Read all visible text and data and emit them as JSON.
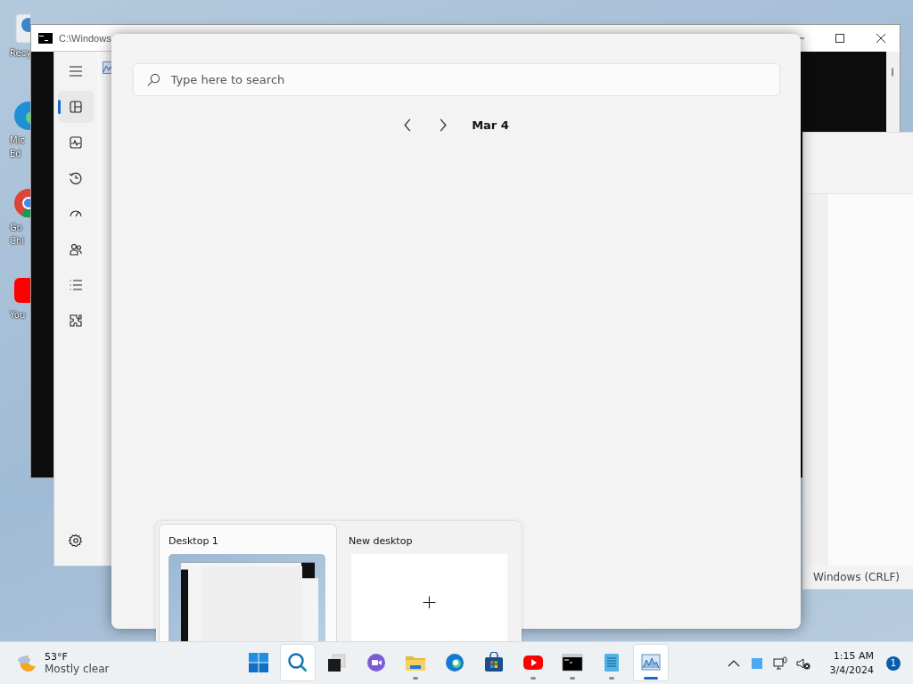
{
  "desktop_icons": [
    {
      "kind": "recycle-bin",
      "lines": [
        "Recy"
      ]
    },
    {
      "kind": "edge",
      "lines": [
        "Mic",
        "Ed"
      ]
    },
    {
      "kind": "chrome",
      "lines": [
        "Go",
        "Chi"
      ]
    },
    {
      "kind": "youtube",
      "lines": [
        "You"
      ]
    }
  ],
  "console_window": {
    "title": "C:\\Windows"
  },
  "notepad_window": {
    "status_encoding": "Windows (CRLF)"
  },
  "task_manager": {
    "sidebar": [
      {
        "kind": "menu",
        "selected": false
      },
      {
        "kind": "processes",
        "selected": true
      },
      {
        "kind": "performance",
        "selected": false
      },
      {
        "kind": "history",
        "selected": false
      },
      {
        "kind": "startup",
        "selected": false
      },
      {
        "kind": "users",
        "selected": false
      },
      {
        "kind": "details",
        "selected": false
      },
      {
        "kind": "services",
        "selected": false
      }
    ],
    "settings": {
      "kind": "settings",
      "selected": false
    }
  },
  "task_view": {
    "search": {
      "placeholder": "Type here to search"
    },
    "date": "Mar 4",
    "desktops": [
      {
        "kind": "existing",
        "name": "Desktop 1",
        "selected": true
      },
      {
        "kind": "new",
        "name": "New desktop",
        "plus": "+"
      }
    ]
  },
  "taskbar": {
    "weather": {
      "temperature": "53°F",
      "condition": "Mostly clear"
    },
    "apps": [
      {
        "kind": "start",
        "running": false,
        "active": false
      },
      {
        "kind": "search",
        "running": false,
        "active": true
      },
      {
        "kind": "taskview",
        "running": false,
        "active": false
      },
      {
        "kind": "chat",
        "running": false,
        "active": false
      },
      {
        "kind": "explorer",
        "running": true,
        "active": false
      },
      {
        "kind": "edge",
        "running": false,
        "active": false
      },
      {
        "kind": "store",
        "running": false,
        "active": false
      },
      {
        "kind": "youtube",
        "running": true,
        "active": false
      },
      {
        "kind": "terminal",
        "running": true,
        "active": false
      },
      {
        "kind": "notepad",
        "running": true,
        "active": false
      },
      {
        "kind": "taskmgr",
        "running": true,
        "active": true
      }
    ],
    "clock": {
      "time": "1:15 AM",
      "date": "3/4/2024"
    },
    "notification_count": "1"
  }
}
